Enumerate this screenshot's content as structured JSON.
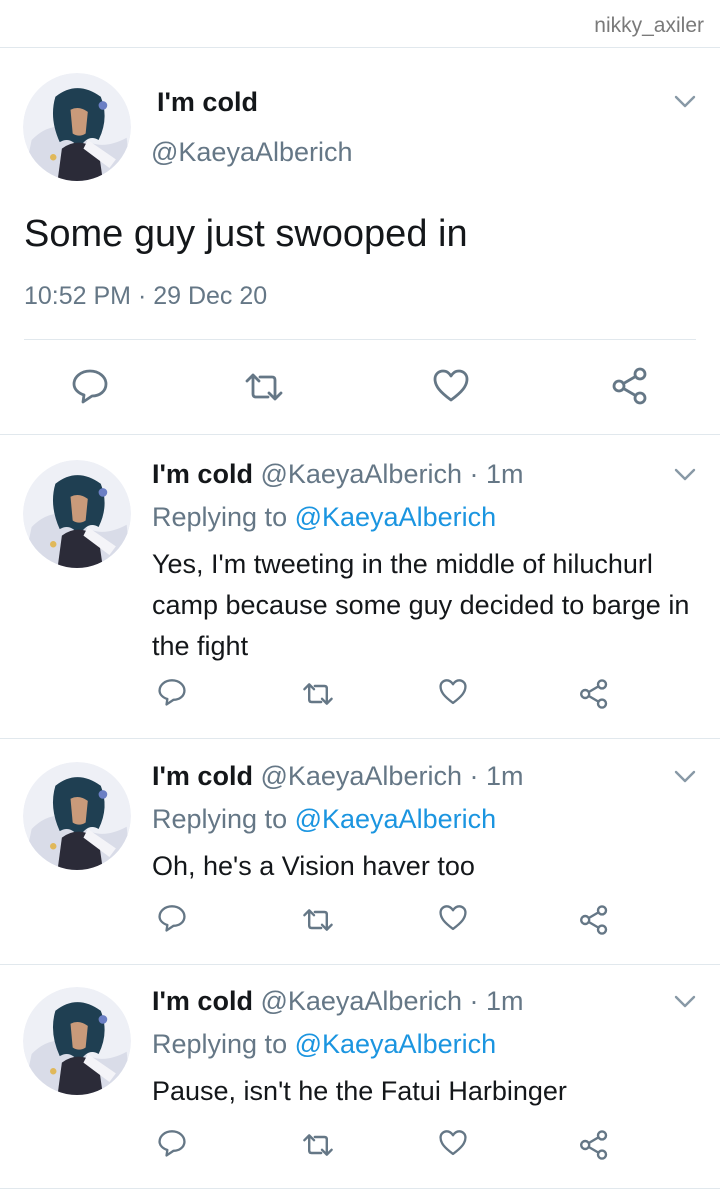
{
  "watermark": "nikky_axiler",
  "colors": {
    "text": "#14171a",
    "secondary": "#657786",
    "link": "#1b95e0",
    "divider": "#e1e8ed"
  },
  "icons": {
    "reply": "reply-icon",
    "retweet": "retweet-icon",
    "like": "like-icon",
    "share": "share-icon",
    "more": "chevron-down-icon"
  },
  "main_tweet": {
    "name": "I'm cold",
    "handle": "@KaeyaAlberich",
    "text": "Some guy just swooped in",
    "timestamp": "10:52 PM · 29 Dec 20"
  },
  "replies": [
    {
      "name": "I'm cold",
      "handle_time": "@KaeyaAlberich · 1m",
      "replying_prefix": "Replying to ",
      "replying_to": "@KaeyaAlberich",
      "text": "Yes, I'm tweeting in the middle of hiluchurl camp because some guy decided to barge in the fight"
    },
    {
      "name": "I'm cold",
      "handle_time": "@KaeyaAlberich · 1m",
      "replying_prefix": "Replying to ",
      "replying_to": "@KaeyaAlberich",
      "text": "Oh, he's a Vision haver too"
    },
    {
      "name": "I'm cold",
      "handle_time": "@KaeyaAlberich · 1m",
      "replying_prefix": "Replying to ",
      "replying_to": "@KaeyaAlberich",
      "text": "Pause, isn't he the Fatui Harbinger"
    }
  ]
}
